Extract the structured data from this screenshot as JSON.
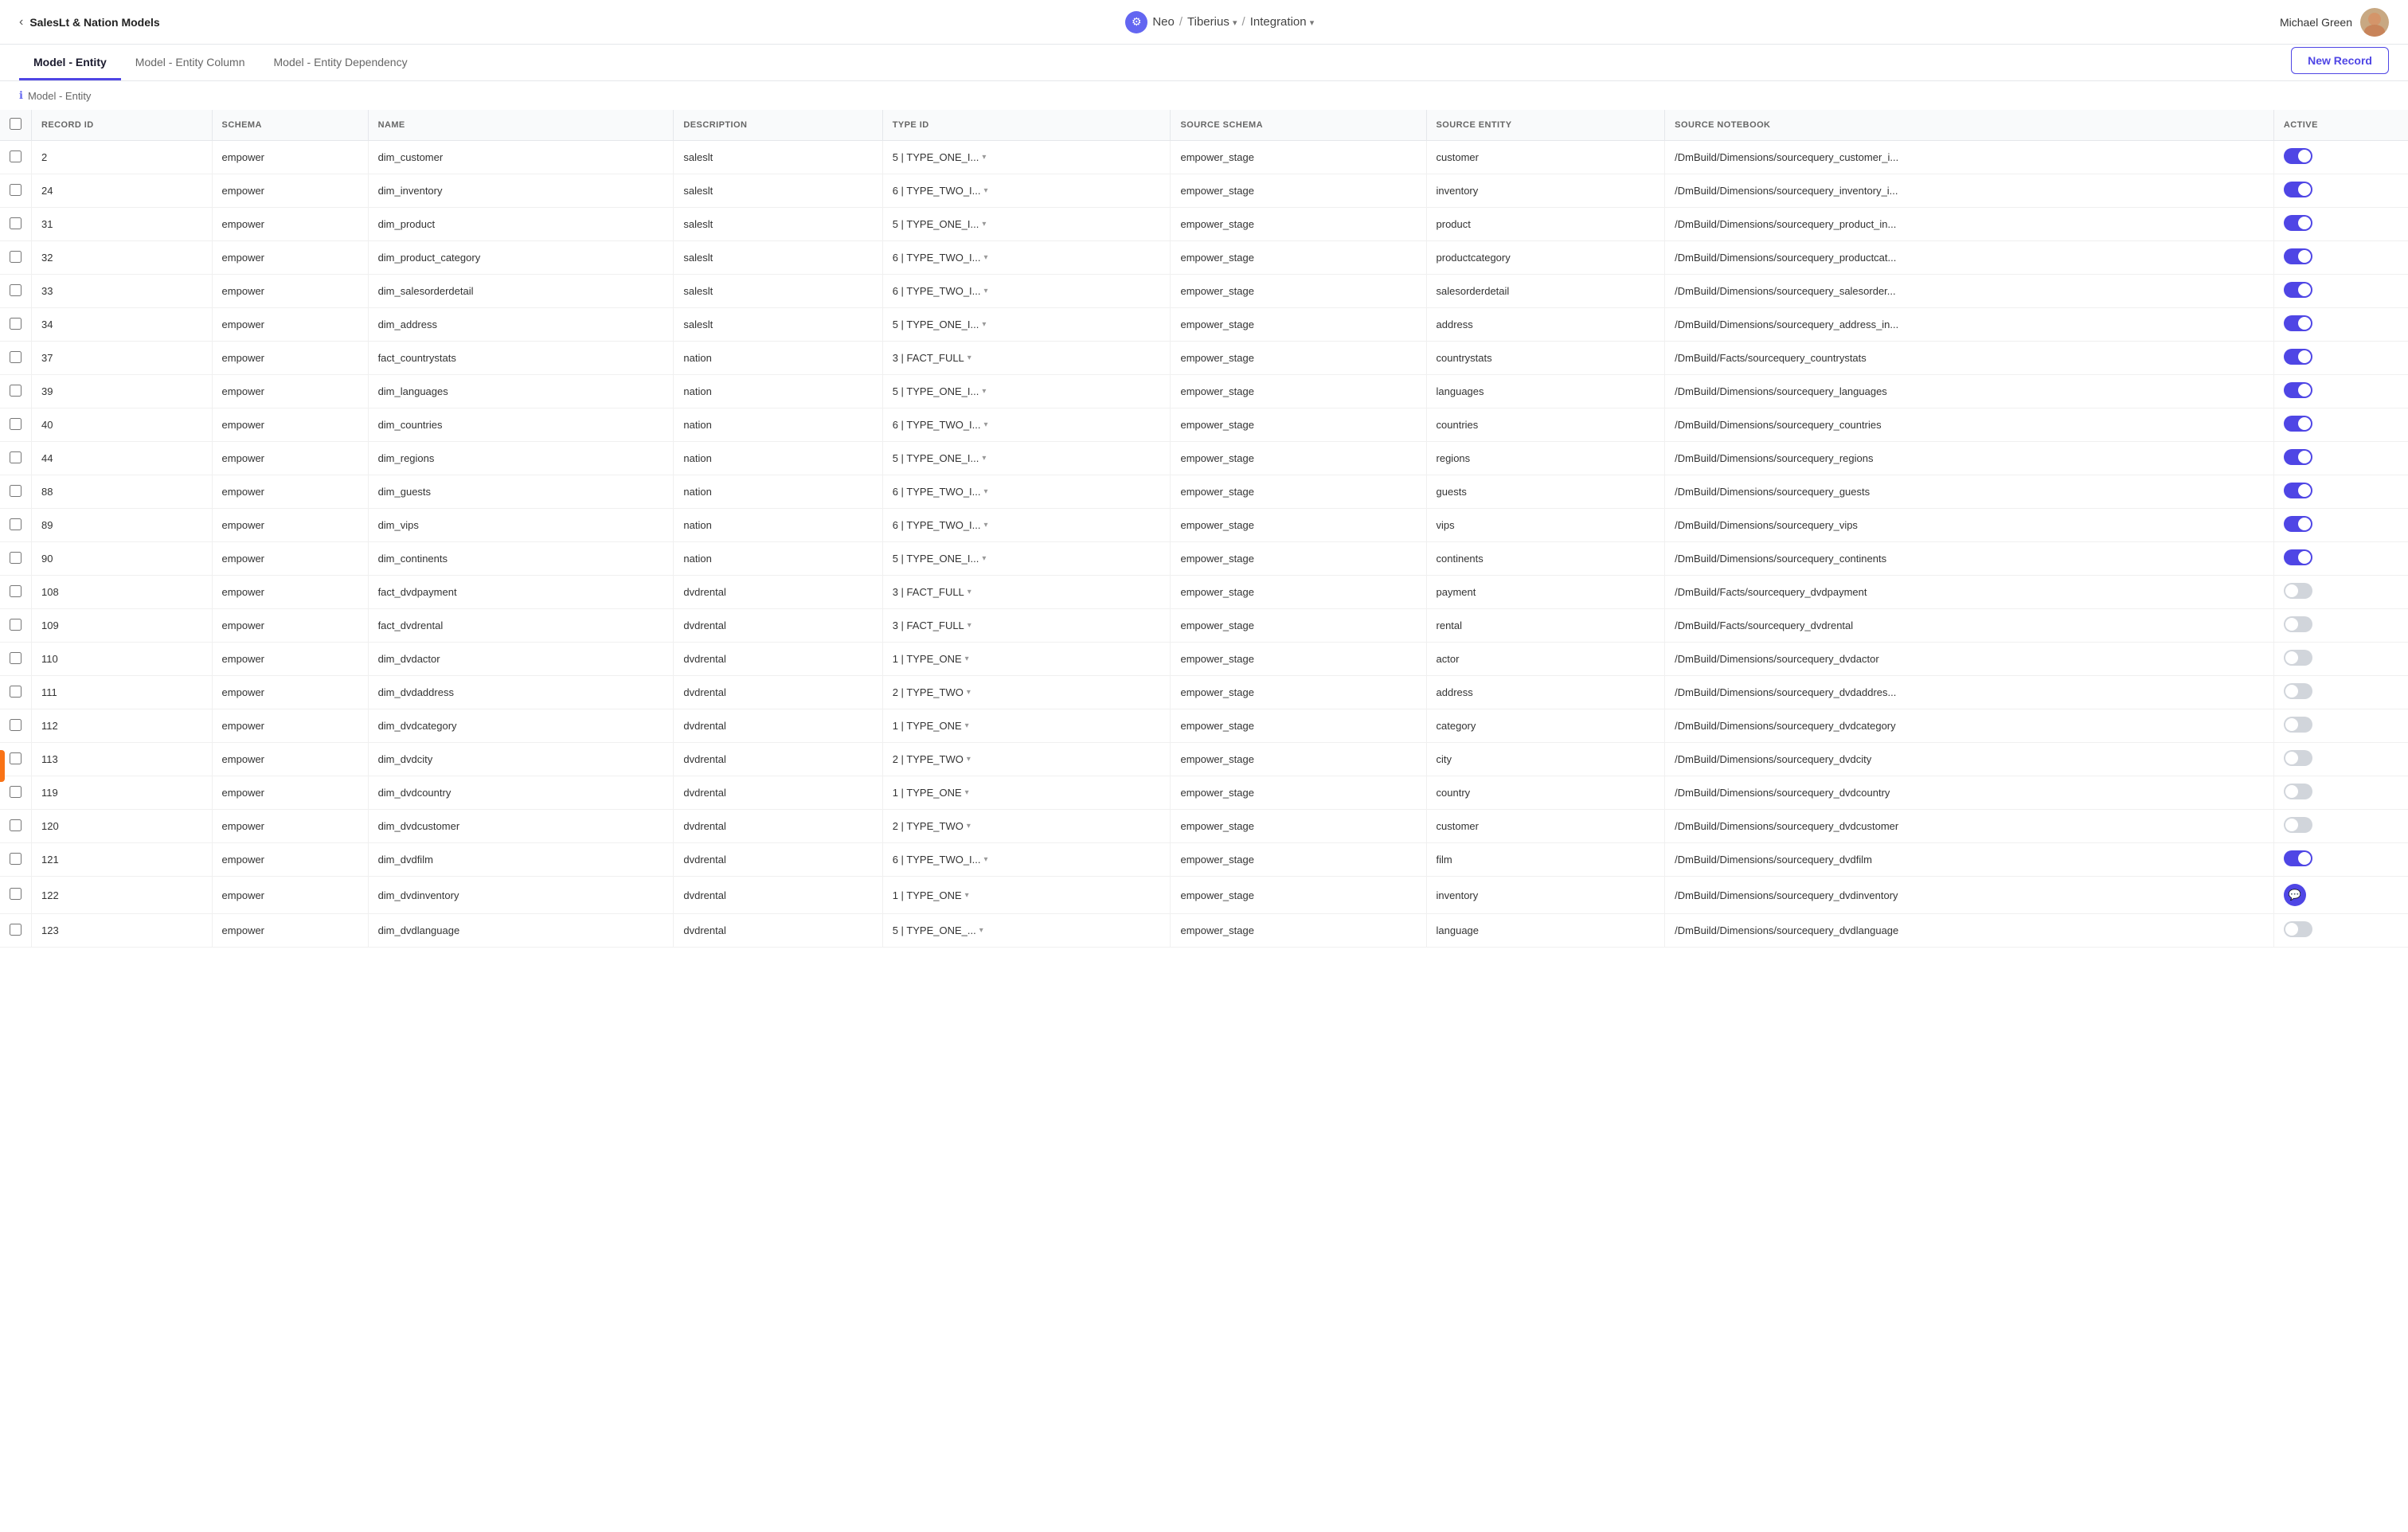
{
  "app": {
    "back_label": "SalesLt & Nation Models",
    "nav_center": {
      "brand": "Neo",
      "sep1": "/",
      "group": "Tiberius",
      "sep2": "/",
      "section": "Integration"
    },
    "user_name": "Michael Green"
  },
  "tabs": [
    {
      "id": "model-entity",
      "label": "Model - Entity",
      "active": true
    },
    {
      "id": "model-entity-column",
      "label": "Model - Entity Column",
      "active": false
    },
    {
      "id": "model-entity-dependency",
      "label": "Model - Entity Dependency",
      "active": false
    }
  ],
  "new_record_label": "New Record",
  "breadcrumb": "Model - Entity",
  "table": {
    "columns": [
      {
        "id": "checkbox",
        "label": ""
      },
      {
        "id": "record_id",
        "label": "RECORD ID"
      },
      {
        "id": "schema",
        "label": "SCHEMA"
      },
      {
        "id": "name",
        "label": "NAME"
      },
      {
        "id": "description",
        "label": "DESCRIPTION"
      },
      {
        "id": "type_id",
        "label": "TYPE ID"
      },
      {
        "id": "source_schema",
        "label": "SOURCE SCHEMA"
      },
      {
        "id": "source_entity",
        "label": "SOURCE ENTITY"
      },
      {
        "id": "source_notebook",
        "label": "SOURCE NOTEBOOK"
      },
      {
        "id": "active",
        "label": "ACTIVE"
      }
    ],
    "rows": [
      {
        "record_id": "2",
        "schema": "empower",
        "name": "dim_customer",
        "description": "saleslt",
        "type_id": "5 | TYPE_ONE_I...",
        "source_schema": "empower_stage",
        "source_entity": "customer",
        "source_notebook": "/DmBuild/Dimensions/sourcequery_customer_i...",
        "active": true
      },
      {
        "record_id": "24",
        "schema": "empower",
        "name": "dim_inventory",
        "description": "saleslt",
        "type_id": "6 | TYPE_TWO_I...",
        "source_schema": "empower_stage",
        "source_entity": "inventory",
        "source_notebook": "/DmBuild/Dimensions/sourcequery_inventory_i...",
        "active": true
      },
      {
        "record_id": "31",
        "schema": "empower",
        "name": "dim_product",
        "description": "saleslt",
        "type_id": "5 | TYPE_ONE_I...",
        "source_schema": "empower_stage",
        "source_entity": "product",
        "source_notebook": "/DmBuild/Dimensions/sourcequery_product_in...",
        "active": true
      },
      {
        "record_id": "32",
        "schema": "empower",
        "name": "dim_product_category",
        "description": "saleslt",
        "type_id": "6 | TYPE_TWO_I...",
        "source_schema": "empower_stage",
        "source_entity": "productcategory",
        "source_notebook": "/DmBuild/Dimensions/sourcequery_productcat...",
        "active": true
      },
      {
        "record_id": "33",
        "schema": "empower",
        "name": "dim_salesorderdetail",
        "description": "saleslt",
        "type_id": "6 | TYPE_TWO_I...",
        "source_schema": "empower_stage",
        "source_entity": "salesorderdetail",
        "source_notebook": "/DmBuild/Dimensions/sourcequery_salesorder...",
        "active": true
      },
      {
        "record_id": "34",
        "schema": "empower",
        "name": "dim_address",
        "description": "saleslt",
        "type_id": "5 | TYPE_ONE_I...",
        "source_schema": "empower_stage",
        "source_entity": "address",
        "source_notebook": "/DmBuild/Dimensions/sourcequery_address_in...",
        "active": true
      },
      {
        "record_id": "37",
        "schema": "empower",
        "name": "fact_countrystats",
        "description": "nation",
        "type_id": "3 | FACT_FULL",
        "source_schema": "empower_stage",
        "source_entity": "countrystats",
        "source_notebook": "/DmBuild/Facts/sourcequery_countrystats",
        "active": true
      },
      {
        "record_id": "39",
        "schema": "empower",
        "name": "dim_languages",
        "description": "nation",
        "type_id": "5 | TYPE_ONE_I...",
        "source_schema": "empower_stage",
        "source_entity": "languages",
        "source_notebook": "/DmBuild/Dimensions/sourcequery_languages",
        "active": true
      },
      {
        "record_id": "40",
        "schema": "empower",
        "name": "dim_countries",
        "description": "nation",
        "type_id": "6 | TYPE_TWO_I...",
        "source_schema": "empower_stage",
        "source_entity": "countries",
        "source_notebook": "/DmBuild/Dimensions/sourcequery_countries",
        "active": true
      },
      {
        "record_id": "44",
        "schema": "empower",
        "name": "dim_regions",
        "description": "nation",
        "type_id": "5 | TYPE_ONE_I...",
        "source_schema": "empower_stage",
        "source_entity": "regions",
        "source_notebook": "/DmBuild/Dimensions/sourcequery_regions",
        "active": true
      },
      {
        "record_id": "88",
        "schema": "empower",
        "name": "dim_guests",
        "description": "nation",
        "type_id": "6 | TYPE_TWO_I...",
        "source_schema": "empower_stage",
        "source_entity": "guests",
        "source_notebook": "/DmBuild/Dimensions/sourcequery_guests",
        "active": true
      },
      {
        "record_id": "89",
        "schema": "empower",
        "name": "dim_vips",
        "description": "nation",
        "type_id": "6 | TYPE_TWO_I...",
        "source_schema": "empower_stage",
        "source_entity": "vips",
        "source_notebook": "/DmBuild/Dimensions/sourcequery_vips",
        "active": true
      },
      {
        "record_id": "90",
        "schema": "empower",
        "name": "dim_continents",
        "description": "nation",
        "type_id": "5 | TYPE_ONE_I...",
        "source_schema": "empower_stage",
        "source_entity": "continents",
        "source_notebook": "/DmBuild/Dimensions/sourcequery_continents",
        "active": true
      },
      {
        "record_id": "108",
        "schema": "empower",
        "name": "fact_dvdpayment",
        "description": "dvdrental",
        "type_id": "3 | FACT_FULL",
        "source_schema": "empower_stage",
        "source_entity": "payment",
        "source_notebook": "/DmBuild/Facts/sourcequery_dvdpayment",
        "active": false
      },
      {
        "record_id": "109",
        "schema": "empower",
        "name": "fact_dvdrental",
        "description": "dvdrental",
        "type_id": "3 | FACT_FULL",
        "source_schema": "empower_stage",
        "source_entity": "rental",
        "source_notebook": "/DmBuild/Facts/sourcequery_dvdrental",
        "active": false
      },
      {
        "record_id": "110",
        "schema": "empower",
        "name": "dim_dvdactor",
        "description": "dvdrental",
        "type_id": "1 | TYPE_ONE",
        "source_schema": "empower_stage",
        "source_entity": "actor",
        "source_notebook": "/DmBuild/Dimensions/sourcequery_dvdactor",
        "active": false
      },
      {
        "record_id": "111",
        "schema": "empower",
        "name": "dim_dvdaddress",
        "description": "dvdrental",
        "type_id": "2 | TYPE_TWO",
        "source_schema": "empower_stage",
        "source_entity": "address",
        "source_notebook": "/DmBuild/Dimensions/sourcequery_dvdaddres...",
        "active": false
      },
      {
        "record_id": "112",
        "schema": "empower",
        "name": "dim_dvdcategory",
        "description": "dvdrental",
        "type_id": "1 | TYPE_ONE",
        "source_schema": "empower_stage",
        "source_entity": "category",
        "source_notebook": "/DmBuild/Dimensions/sourcequery_dvdcategory",
        "active": false
      },
      {
        "record_id": "113",
        "schema": "empower",
        "name": "dim_dvdcity",
        "description": "dvdrental",
        "type_id": "2 | TYPE_TWO",
        "source_schema": "empower_stage",
        "source_entity": "city",
        "source_notebook": "/DmBuild/Dimensions/sourcequery_dvdcity",
        "active": false
      },
      {
        "record_id": "119",
        "schema": "empower",
        "name": "dim_dvdcountry",
        "description": "dvdrental",
        "type_id": "1 | TYPE_ONE",
        "source_schema": "empower_stage",
        "source_entity": "country",
        "source_notebook": "/DmBuild/Dimensions/sourcequery_dvdcountry",
        "active": false
      },
      {
        "record_id": "120",
        "schema": "empower",
        "name": "dim_dvdcustomer",
        "description": "dvdrental",
        "type_id": "2 | TYPE_TWO",
        "source_schema": "empower_stage",
        "source_entity": "customer",
        "source_notebook": "/DmBuild/Dimensions/sourcequery_dvdcustomer",
        "active": false
      },
      {
        "record_id": "121",
        "schema": "empower",
        "name": "dim_dvdfilm",
        "description": "dvdrental",
        "type_id": "6 | TYPE_TWO_I...",
        "source_schema": "empower_stage",
        "source_entity": "film",
        "source_notebook": "/DmBuild/Dimensions/sourcequery_dvdfilm",
        "active": true
      },
      {
        "record_id": "122",
        "schema": "empower",
        "name": "dim_dvdinventory",
        "description": "dvdrental",
        "type_id": "1 | TYPE_ONE",
        "source_schema": "empower_stage",
        "source_entity": "inventory",
        "source_notebook": "/DmBuild/Dimensions/sourcequery_dvdinventory",
        "active": false,
        "has_chat": true
      },
      {
        "record_id": "123",
        "schema": "empower",
        "name": "dim_dvdlanguage",
        "description": "dvdrental",
        "type_id": "5 | TYPE_ONE_...",
        "source_schema": "empower_stage",
        "source_entity": "language",
        "source_notebook": "/DmBuild/Dimensions/sourcequery_dvdlanguage",
        "active": false
      }
    ]
  }
}
